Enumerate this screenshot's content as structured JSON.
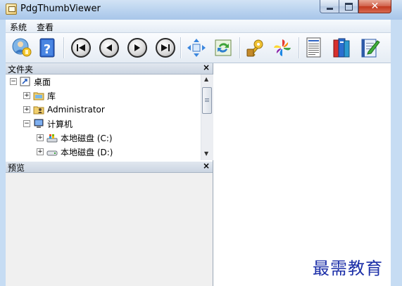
{
  "window": {
    "title": "PdgThumbViewer"
  },
  "menu": [
    "系统",
    "查看"
  ],
  "toolbar": {
    "buttons": [
      "user-icon",
      "help-icon",
      "first-page-icon",
      "previous-page-icon",
      "next-page-icon",
      "last-page-icon",
      "fit-page-icon",
      "refresh-icon",
      "key-icon",
      "pinwheel-icon",
      "document-list-icon",
      "books-icon",
      "edit-notebook-icon"
    ]
  },
  "folder_pane": {
    "title": "文件夹",
    "close": "×",
    "tree": [
      {
        "label": "桌面",
        "expander": "−",
        "icon": "desktop-icon"
      },
      {
        "label": "库",
        "expander": "+",
        "icon": "library-folder-icon"
      },
      {
        "label": "Administrator",
        "expander": "+",
        "icon": "user-folder-icon"
      },
      {
        "label": "计算机",
        "expander": "−",
        "icon": "computer-icon"
      },
      {
        "label": "本地磁盘 (C:)",
        "expander": "+",
        "icon": "system-drive-icon"
      },
      {
        "label": "本地磁盘 (D:)",
        "expander": "+",
        "icon": "drive-icon"
      }
    ]
  },
  "preview_pane": {
    "title": "预览",
    "close": "×"
  },
  "watermark": "最需教育"
}
